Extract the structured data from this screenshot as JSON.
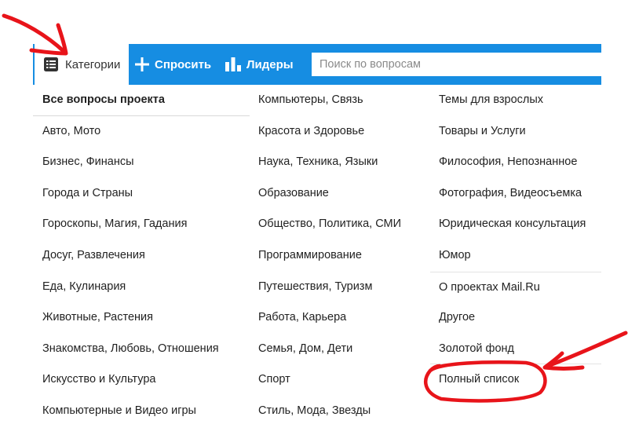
{
  "nav": {
    "categories_label": "Категории",
    "ask_label": "Спросить",
    "leaders_label": "Лидеры",
    "search_placeholder": "Поиск по вопросам"
  },
  "columns": [
    {
      "items": [
        "Все вопросы проекта",
        "Авто, Мото",
        "Бизнес, Финансы",
        "Города и Страны",
        "Гороскопы, Магия, Гадания",
        "Досуг, Развлечения",
        "Еда, Кулинария",
        "Животные, Растения",
        "Знакомства, Любовь, Отношения",
        "Искусство и Культура",
        "Компьютерные и Видео игры"
      ]
    },
    {
      "items": [
        "Компьютеры, Связь",
        "Красота и Здоровье",
        "Наука, Техника, Языки",
        "Образование",
        "Общество, Политика, СМИ",
        "Программирование",
        "Путешествия, Туризм",
        "Работа, Карьера",
        "Семья, Дом, Дети",
        "Спорт",
        "Стиль, Мода, Звезды"
      ]
    },
    {
      "items": [
        "Темы для взрослых",
        "Товары и Услуги",
        "Философия, Непознанное",
        "Фотография, Видеосъемка",
        "Юридическая консультация",
        "Юмор",
        "О проектах Mail.Ru",
        "Другое",
        "Золотой фонд",
        "Полный список"
      ]
    }
  ],
  "colors": {
    "accent": "#168de2",
    "annotation": "#e8141a"
  },
  "icons": {
    "categories": "list-icon",
    "ask": "plus-icon",
    "leaders": "bar-chart-icon"
  }
}
